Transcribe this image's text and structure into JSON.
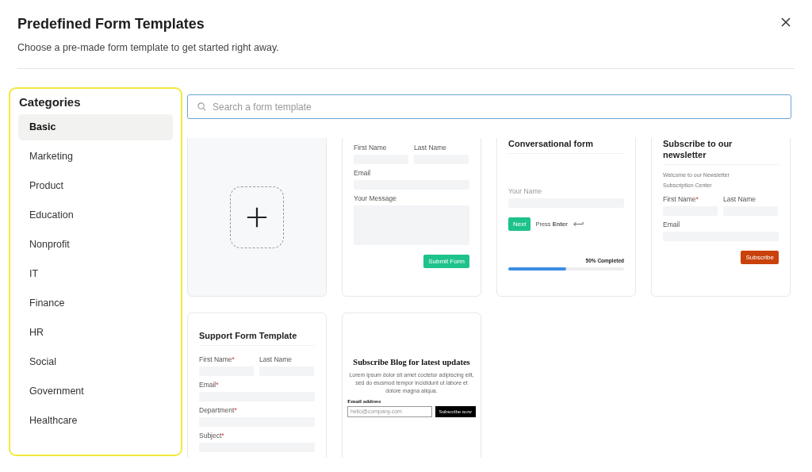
{
  "dialog": {
    "title": "Predefined Form Templates",
    "subtitle": "Choose a pre-made form template to get started right away."
  },
  "sidebar": {
    "title": "Categories",
    "items": [
      {
        "label": "Basic",
        "selected": true
      },
      {
        "label": "Marketing",
        "selected": false
      },
      {
        "label": "Product",
        "selected": false
      },
      {
        "label": "Education",
        "selected": false
      },
      {
        "label": "Nonprofit",
        "selected": false
      },
      {
        "label": "IT",
        "selected": false
      },
      {
        "label": "Finance",
        "selected": false
      },
      {
        "label": "HR",
        "selected": false
      },
      {
        "label": "Social",
        "selected": false
      },
      {
        "label": "Government",
        "selected": false
      },
      {
        "label": "Healthcare",
        "selected": false
      }
    ]
  },
  "search": {
    "placeholder": "Search a form template"
  },
  "templates": [
    {
      "kind": "blank"
    },
    {
      "kind": "form",
      "fields": [
        {
          "kind": "half",
          "label": "First Name"
        },
        {
          "kind": "half",
          "label": "Last Name"
        },
        {
          "kind": "full",
          "label": "Email"
        },
        {
          "kind": "textarea",
          "label": "Your Message"
        }
      ],
      "button": "Submit Form",
      "color": "#1ec28b"
    },
    {
      "kind": "conversational",
      "title": "Conversational form",
      "field": "Your Name",
      "button": "Next",
      "hint": "Press **Enter**",
      "progress_label": "50% Completed",
      "level": 0.5
    },
    {
      "kind": "form",
      "title": "Subscribe to our newsletter",
      "intro": "Welcome to our Newsletter Subscription Center",
      "fields": [
        {
          "kind": "half",
          "label": "First Name",
          "required_mark": "*"
        },
        {
          "kind": "half",
          "label": "Last Name"
        },
        {
          "kind": "full",
          "label": "Email"
        }
      ],
      "button": "Subscribe",
      "color": "#c9410b"
    },
    {
      "kind": "form",
      "title": "Support Form Template",
      "fields": [
        {
          "kind": "half",
          "label": "First Name",
          "required_mark": "*"
        },
        {
          "kind": "half",
          "label": "Last Name"
        },
        {
          "kind": "full",
          "label": "Email",
          "required_mark": "*"
        },
        {
          "kind": "full",
          "label": "Department",
          "required_mark": "*"
        },
        {
          "kind": "full",
          "label": "Subject",
          "required_mark": "*"
        }
      ]
    },
    {
      "kind": "blog",
      "title": "Subscribe Blog for latest updates",
      "body": "Lorem ipsum dolor sit amet coctetur adipiscing elit, sed do eiusmod tempor incididunt ut labore et dolore magna aliqua.",
      "field": "Email address",
      "placeholder": "hello@company.com",
      "button": "Subscribe now"
    }
  ]
}
